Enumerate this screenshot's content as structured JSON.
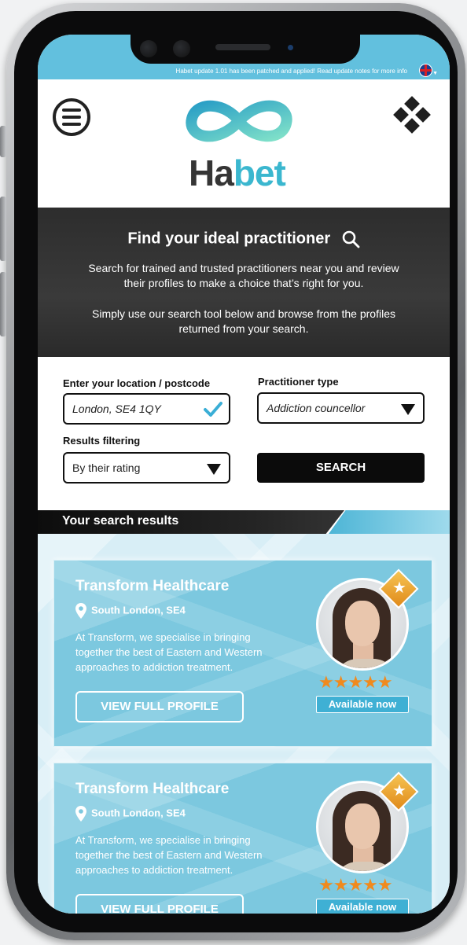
{
  "status_bar": {
    "update_message": "Habet update 1.01 has been patched and applied! Read update notes for more info",
    "language_icon": "uk-flag-icon"
  },
  "header": {
    "logo_text_dark": "Ha",
    "logo_text_light": "bet",
    "menu_icon": "hamburger-menu-icon",
    "grid_icon": "diamond-grid-icon"
  },
  "hero": {
    "title": "Find your ideal practitioner",
    "paragraph_1": "Search for trained and trusted practitioners near you and review their profiles to make a choice that’s right for you.",
    "paragraph_2": "Simply use our search tool below and browse from the profiles returned from your search."
  },
  "search_form": {
    "location_label": "Enter your location / postcode",
    "location_value": "London, SE4 1QY",
    "type_label": "Practitioner type",
    "type_value": "Addiction councellor",
    "filter_label": "Results filtering",
    "filter_value": "By their rating",
    "search_button": "SEARCH"
  },
  "results": {
    "heading": "Your search results",
    "cards": [
      {
        "name": "Transform Healthcare",
        "location": "South London, SE4",
        "description": "At Transform, we specialise in bringing together the best of Eastern and Western approaches to addiction treatment.",
        "button": "VIEW FULL PROFILE",
        "rating_stars": "★★★★★",
        "rating": 5,
        "availability": "Available now"
      },
      {
        "name": "Transform Healthcare",
        "location": "South London, SE4",
        "description": "At Transform, we specialise in bringing together the best of Eastern and Western approaches to addiction treatment.",
        "button": "VIEW FULL PROFILE",
        "rating_stars": "★★★★★",
        "rating": 5,
        "availability": "Available now"
      }
    ]
  },
  "colors": {
    "accent": "#62c0de",
    "brand_dark": "#353535",
    "brand_light": "#3bb7cf",
    "star": "#f08a1e"
  }
}
